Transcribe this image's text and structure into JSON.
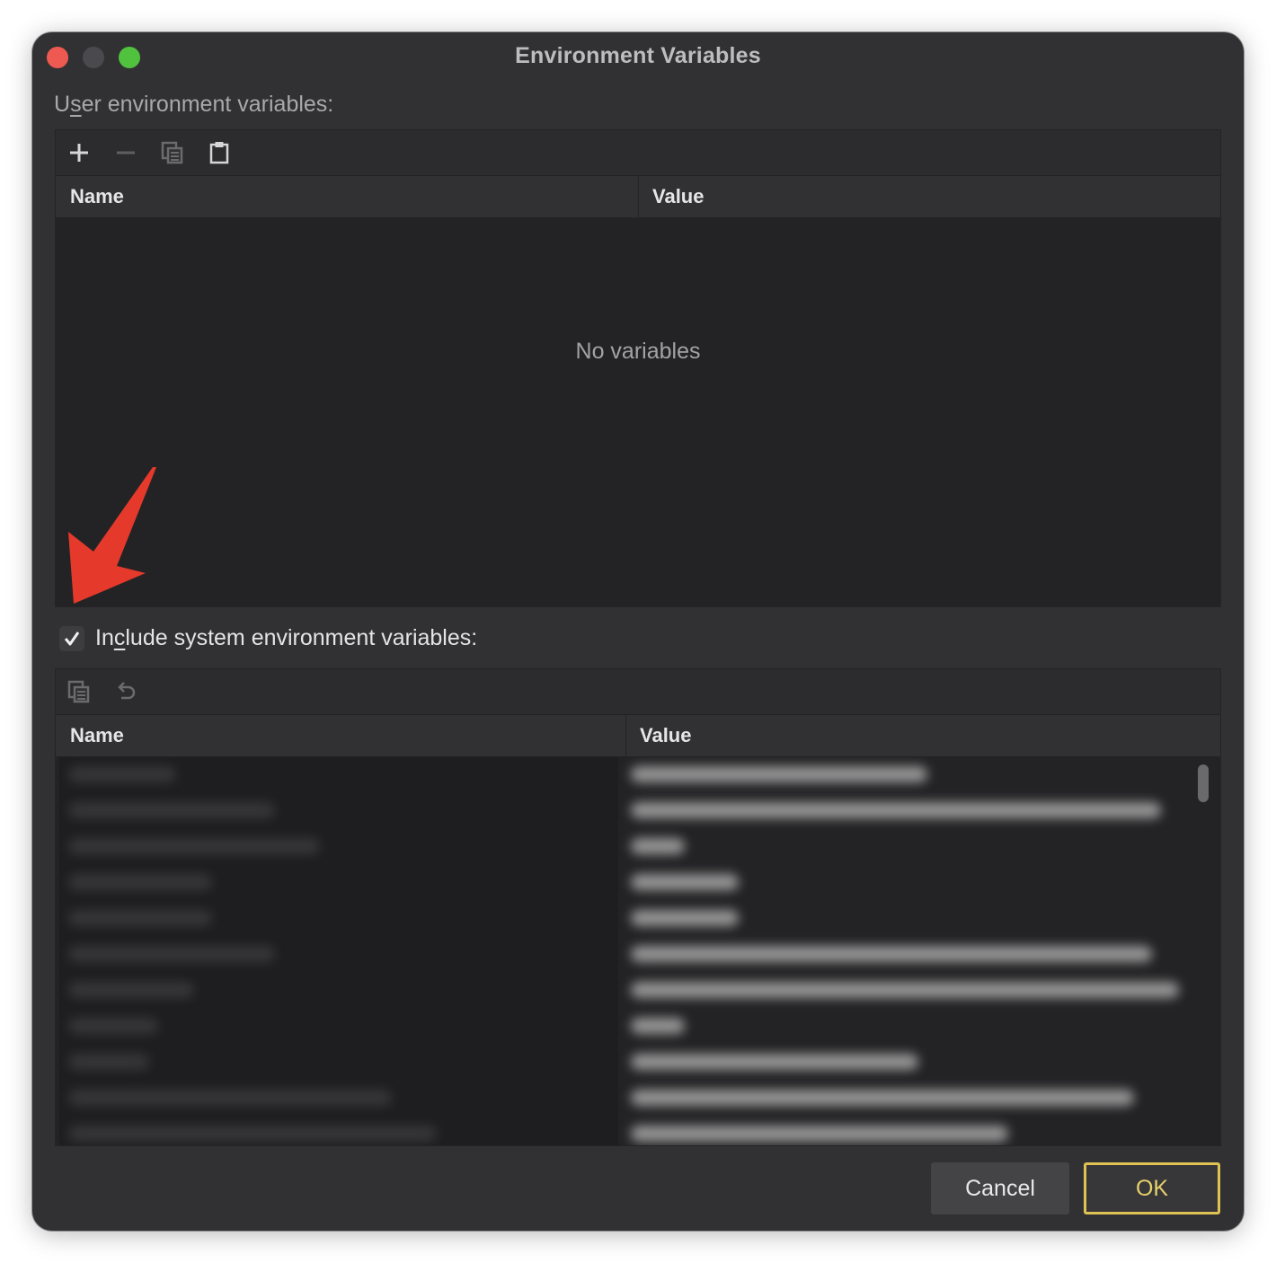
{
  "window": {
    "title": "Environment Variables"
  },
  "user_section": {
    "label_pre": "U",
    "label_mnemonic": "s",
    "label_post": "er environment variables:",
    "toolbar": [
      "add-icon",
      "remove-icon",
      "copy-icon",
      "paste-icon"
    ],
    "columns": {
      "name": "Name",
      "value": "Value"
    },
    "empty_message": "No variables"
  },
  "system_section": {
    "checkbox_checked": true,
    "label_pre": "In",
    "label_mnemonic": "c",
    "label_post": "lude system environment variables:",
    "toolbar": [
      "copy-icon",
      "undo-icon"
    ],
    "columns": {
      "name": "Name",
      "value": "Value"
    }
  },
  "buttons": {
    "cancel": "Cancel",
    "ok": "OK"
  },
  "colors": {
    "window_bg": "#313134",
    "accent_ok": "#e0c252",
    "annotation_arrow": "#e53a2b"
  }
}
